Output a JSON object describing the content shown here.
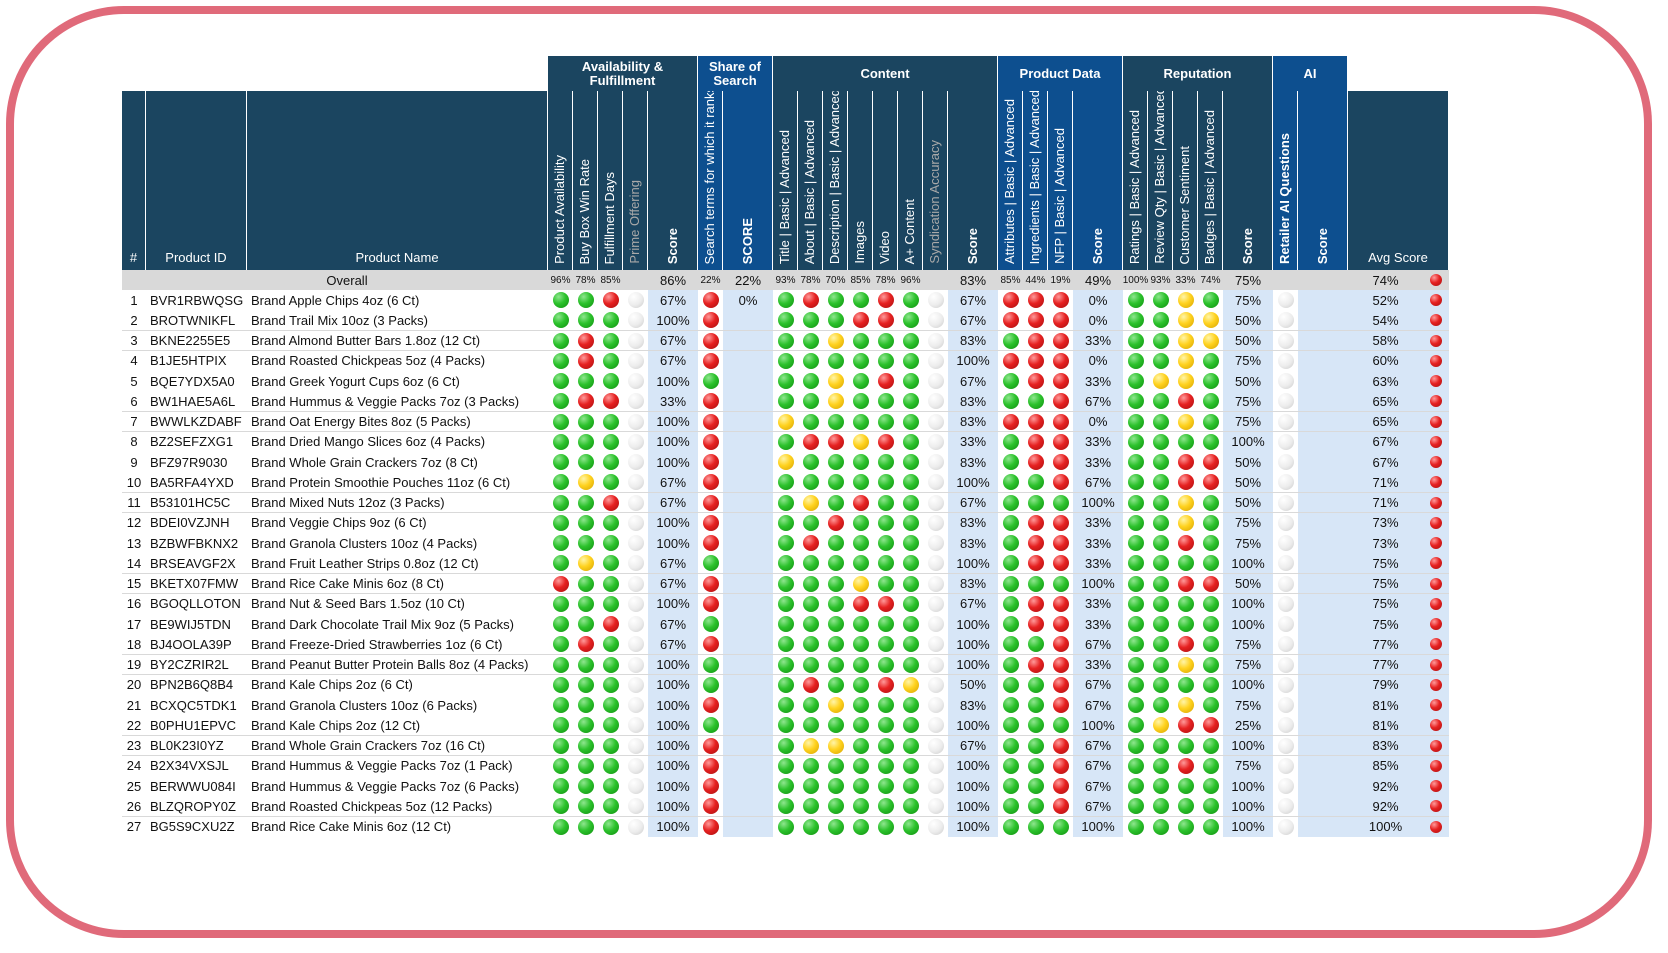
{
  "groups": [
    {
      "label": "Availability & Fulfillment",
      "color": "#1b4560"
    },
    {
      "label": "Share of Search",
      "color": "#0d4f8f"
    },
    {
      "label": "Content",
      "color": "#1b4560"
    },
    {
      "label": "Product Data",
      "color": "#0d4f8f"
    },
    {
      "label": "Reputation",
      "color": "#1b4560"
    },
    {
      "label": "AI",
      "color": "#0d4f8f"
    }
  ],
  "headers": {
    "num": "#",
    "product_id": "Product ID",
    "product_name": "Product Name",
    "metrics": [
      "Product Availability",
      "Buy Box Win Rate",
      "Fulfillment Days",
      "Prime Offering",
      "Score",
      "Search terms for which it ranks",
      "SCORE",
      "Title | Basic | Advanced",
      "About | Basic | Advanced",
      "Description | Basic | Advanced",
      "Images",
      "Video",
      "A+ Content",
      "Syndication Accuracy",
      "Score",
      "Attributes | Basic | Advanced",
      "Ingredients | Basic | Advanced",
      "NFP | Basic | Advanced",
      "Score",
      "Ratings | Basic | Advanced",
      "Review Qty | Basic | Advanced",
      "Customer Sentiment",
      "Badges | Basic | Advanced",
      "Score",
      "Retailer AI Questions",
      "Score"
    ],
    "avg_score": "Avg Score"
  },
  "overall": {
    "label": "Overall",
    "values": [
      "96%",
      "78%",
      "85%",
      "",
      "86%",
      "22%",
      "22%",
      "93%",
      "78%",
      "70%",
      "85%",
      "78%",
      "96%",
      "",
      "83%",
      "85%",
      "44%",
      "19%",
      "49%",
      "100%",
      "93%",
      "33%",
      "74%",
      "75%",
      "",
      ""
    ],
    "avg": "74%",
    "status": "R"
  },
  "rows": [
    {
      "num": "1",
      "id": "BVR1RBWQSG",
      "name": "Brand Apple Chips 4oz (6 Ct)",
      "af": "GGRN",
      "af_score": "67%",
      "sos": "R",
      "sos_score": "0%",
      "content": "GRGGRGN",
      "content_score": "67%",
      "pd": "RRR",
      "pd_score": "0%",
      "rep": "GGYG",
      "rep_score": "75%",
      "ai": "N",
      "ai_score": "",
      "avg": "52%",
      "status": "R"
    },
    {
      "num": "2",
      "id": "BROTWNIKFL",
      "name": "Brand Trail Mix 10oz (3 Packs)",
      "af": "GGGN",
      "af_score": "100%",
      "sos": "R",
      "sos_score": "",
      "content": "GGGRRGN",
      "content_score": "67%",
      "pd": "RRR",
      "pd_score": "0%",
      "rep": "GGYY",
      "rep_score": "50%",
      "ai": "N",
      "ai_score": "",
      "avg": "54%",
      "status": "R"
    },
    {
      "num": "3",
      "id": "BKNE2255E5",
      "name": "Brand Almond Butter Bars 1.8oz (12 Ct)",
      "af": "GRGN",
      "af_score": "67%",
      "sos": "R",
      "sos_score": "",
      "content": "GGYGGGN",
      "content_score": "83%",
      "pd": "GRR",
      "pd_score": "33%",
      "rep": "GGYY",
      "rep_score": "50%",
      "ai": "N",
      "ai_score": "",
      "avg": "58%",
      "status": "R"
    },
    {
      "num": "4",
      "id": "B1JE5HTPIX",
      "name": "Brand Roasted Chickpeas 5oz (4 Packs)",
      "af": "GRGN",
      "af_score": "67%",
      "sos": "R",
      "sos_score": "",
      "content": "GGGGGGN",
      "content_score": "100%",
      "pd": "RRR",
      "pd_score": "0%",
      "rep": "GGYG",
      "rep_score": "75%",
      "ai": "N",
      "ai_score": "",
      "avg": "60%",
      "status": "R"
    },
    {
      "num": "5",
      "id": "BQE7YDX5A0",
      "name": "Brand Greek Yogurt Cups 6oz (6 Ct)",
      "af": "GGGN",
      "af_score": "100%",
      "sos": "G",
      "sos_score": "",
      "content": "GGYGRGN",
      "content_score": "67%",
      "pd": "GRR",
      "pd_score": "33%",
      "rep": "GYYG",
      "rep_score": "50%",
      "ai": "N",
      "ai_score": "",
      "avg": "63%",
      "status": "R"
    },
    {
      "num": "6",
      "id": "BW1HAE5A6L",
      "name": "Brand Hummus & Veggie Packs 7oz (3 Packs)",
      "af": "GRRN",
      "af_score": "33%",
      "sos": "R",
      "sos_score": "",
      "content": "GGYGGGN",
      "content_score": "83%",
      "pd": "GGR",
      "pd_score": "67%",
      "rep": "GGRG",
      "rep_score": "75%",
      "ai": "N",
      "ai_score": "",
      "avg": "65%",
      "status": "R"
    },
    {
      "num": "7",
      "id": "BWWLKZDABF",
      "name": "Brand Oat Energy Bites 8oz (5 Packs)",
      "af": "GGGN",
      "af_score": "100%",
      "sos": "R",
      "sos_score": "",
      "content": "YGGGGGN",
      "content_score": "83%",
      "pd": "RRR",
      "pd_score": "0%",
      "rep": "GGYG",
      "rep_score": "75%",
      "ai": "N",
      "ai_score": "",
      "avg": "65%",
      "status": "R"
    },
    {
      "num": "8",
      "id": "BZ2SEFZXG1",
      "name": "Brand Dried Mango Slices 6oz (4 Packs)",
      "af": "GGGN",
      "af_score": "100%",
      "sos": "R",
      "sos_score": "",
      "content": "GRRYRGN",
      "content_score": "33%",
      "pd": "GRR",
      "pd_score": "33%",
      "rep": "GGGG",
      "rep_score": "100%",
      "ai": "N",
      "ai_score": "",
      "avg": "67%",
      "status": "R"
    },
    {
      "num": "9",
      "id": "BFZ97R9030",
      "name": "Brand Whole Grain Crackers 7oz (8 Ct)",
      "af": "GGGN",
      "af_score": "100%",
      "sos": "R",
      "sos_score": "",
      "content": "YGGGGGN",
      "content_score": "83%",
      "pd": "GRR",
      "pd_score": "33%",
      "rep": "GGRR",
      "rep_score": "50%",
      "ai": "N",
      "ai_score": "",
      "avg": "67%",
      "status": "R"
    },
    {
      "num": "10",
      "id": "BA5RFA4YXD",
      "name": "Brand Protein Smoothie Pouches 11oz (6 Ct)",
      "af": "GYGN",
      "af_score": "67%",
      "sos": "R",
      "sos_score": "",
      "content": "GGGGGGN",
      "content_score": "100%",
      "pd": "GGR",
      "pd_score": "67%",
      "rep": "GGRR",
      "rep_score": "50%",
      "ai": "N",
      "ai_score": "",
      "avg": "71%",
      "status": "R"
    },
    {
      "num": "11",
      "id": "B53101HC5C",
      "name": "Brand Mixed Nuts 12oz (3 Packs)",
      "af": "GGRN",
      "af_score": "67%",
      "sos": "R",
      "sos_score": "",
      "content": "GYGRGGN",
      "content_score": "67%",
      "pd": "GGG",
      "pd_score": "100%",
      "rep": "GGYG",
      "rep_score": "50%",
      "ai": "N",
      "ai_score": "",
      "avg": "71%",
      "status": "R"
    },
    {
      "num": "12",
      "id": "BDEI0VZJNH",
      "name": "Brand Veggie Chips 9oz (6 Ct)",
      "af": "GGGN",
      "af_score": "100%",
      "sos": "R",
      "sos_score": "",
      "content": "GGRGGGN",
      "content_score": "83%",
      "pd": "GRR",
      "pd_score": "33%",
      "rep": "GGYG",
      "rep_score": "75%",
      "ai": "N",
      "ai_score": "",
      "avg": "73%",
      "status": "R"
    },
    {
      "num": "13",
      "id": "BZBWFBKNX2",
      "name": "Brand Granola Clusters 10oz (4 Packs)",
      "af": "GGGN",
      "af_score": "100%",
      "sos": "R",
      "sos_score": "",
      "content": "GRGGGGN",
      "content_score": "83%",
      "pd": "GRR",
      "pd_score": "33%",
      "rep": "GGRG",
      "rep_score": "75%",
      "ai": "N",
      "ai_score": "",
      "avg": "73%",
      "status": "R"
    },
    {
      "num": "14",
      "id": "BRSEAVGF2X",
      "name": "Brand Fruit Leather Strips 0.8oz (12 Ct)",
      "af": "GYGN",
      "af_score": "67%",
      "sos": "G",
      "sos_score": "",
      "content": "GGGGGGN",
      "content_score": "100%",
      "pd": "GRR",
      "pd_score": "33%",
      "rep": "GGGG",
      "rep_score": "100%",
      "ai": "N",
      "ai_score": "",
      "avg": "75%",
      "status": "R"
    },
    {
      "num": "15",
      "id": "BKETX07FMW",
      "name": "Brand Rice Cake Minis 6oz (8 Ct)",
      "af": "RGGN",
      "af_score": "67%",
      "sos": "R",
      "sos_score": "",
      "content": "GGGYGGN",
      "content_score": "83%",
      "pd": "GGG",
      "pd_score": "100%",
      "rep": "GGRR",
      "rep_score": "50%",
      "ai": "N",
      "ai_score": "",
      "avg": "75%",
      "status": "R"
    },
    {
      "num": "16",
      "id": "BGOQLLOTON",
      "name": "Brand Nut & Seed Bars 1.5oz (10 Ct)",
      "af": "GGGN",
      "af_score": "100%",
      "sos": "R",
      "sos_score": "",
      "content": "GGGRRGN",
      "content_score": "67%",
      "pd": "GRR",
      "pd_score": "33%",
      "rep": "GGGG",
      "rep_score": "100%",
      "ai": "N",
      "ai_score": "",
      "avg": "75%",
      "status": "R"
    },
    {
      "num": "17",
      "id": "BE9WIJ5TDN",
      "name": "Brand Dark Chocolate Trail Mix 9oz (5 Packs)",
      "af": "GGRN",
      "af_score": "67%",
      "sos": "G",
      "sos_score": "",
      "content": "GGGGGGN",
      "content_score": "100%",
      "pd": "GRR",
      "pd_score": "33%",
      "rep": "GGGG",
      "rep_score": "100%",
      "ai": "N",
      "ai_score": "",
      "avg": "75%",
      "status": "R"
    },
    {
      "num": "18",
      "id": "BJ4OOLA39P",
      "name": "Brand Freeze-Dried Strawberries 1oz (6 Ct)",
      "af": "GRGN",
      "af_score": "67%",
      "sos": "R",
      "sos_score": "",
      "content": "GGGGGGN",
      "content_score": "100%",
      "pd": "GGR",
      "pd_score": "67%",
      "rep": "GGRG",
      "rep_score": "75%",
      "ai": "N",
      "ai_score": "",
      "avg": "77%",
      "status": "R"
    },
    {
      "num": "19",
      "id": "BY2CZRIR2L",
      "name": "Brand Peanut Butter Protein Balls 8oz (4 Packs)",
      "af": "GGGN",
      "af_score": "100%",
      "sos": "G",
      "sos_score": "",
      "content": "GGGGGGN",
      "content_score": "100%",
      "pd": "GRR",
      "pd_score": "33%",
      "rep": "GGYG",
      "rep_score": "75%",
      "ai": "N",
      "ai_score": "",
      "avg": "77%",
      "status": "R"
    },
    {
      "num": "20",
      "id": "BPN2B6Q8B4",
      "name": "Brand Kale Chips 2oz (6 Ct)",
      "af": "GGGN",
      "af_score": "100%",
      "sos": "G",
      "sos_score": "",
      "content": "GRGGRYN",
      "content_score": "50%",
      "pd": "GGR",
      "pd_score": "67%",
      "rep": "GGGG",
      "rep_score": "100%",
      "ai": "N",
      "ai_score": "",
      "avg": "79%",
      "status": "R"
    },
    {
      "num": "21",
      "id": "BCXQC5TDK1",
      "name": "Brand Granola Clusters 10oz (6 Packs)",
      "af": "GGGN",
      "af_score": "100%",
      "sos": "R",
      "sos_score": "",
      "content": "GGYGGGN",
      "content_score": "83%",
      "pd": "GGR",
      "pd_score": "67%",
      "rep": "GGYG",
      "rep_score": "75%",
      "ai": "N",
      "ai_score": "",
      "avg": "81%",
      "status": "R"
    },
    {
      "num": "22",
      "id": "B0PHU1EPVC",
      "name": "Brand Kale Chips 2oz (12 Ct)",
      "af": "GGGN",
      "af_score": "100%",
      "sos": "G",
      "sos_score": "",
      "content": "GGGGGGN",
      "content_score": "100%",
      "pd": "GGG",
      "pd_score": "100%",
      "rep": "GYRR",
      "rep_score": "25%",
      "ai": "N",
      "ai_score": "",
      "avg": "81%",
      "status": "R"
    },
    {
      "num": "23",
      "id": "BL0K23I0YZ",
      "name": "Brand Whole Grain Crackers 7oz (16 Ct)",
      "af": "GGGN",
      "af_score": "100%",
      "sos": "R",
      "sos_score": "",
      "content": "GYYGGGN",
      "content_score": "67%",
      "pd": "GGR",
      "pd_score": "67%",
      "rep": "GGGG",
      "rep_score": "100%",
      "ai": "N",
      "ai_score": "",
      "avg": "83%",
      "status": "R"
    },
    {
      "num": "24",
      "id": "B2X34VXSJL",
      "name": "Brand Hummus & Veggie Packs 7oz (1 Pack)",
      "af": "GGGN",
      "af_score": "100%",
      "sos": "R",
      "sos_score": "",
      "content": "GGGGGGN",
      "content_score": "100%",
      "pd": "GGR",
      "pd_score": "67%",
      "rep": "GGRG",
      "rep_score": "75%",
      "ai": "N",
      "ai_score": "",
      "avg": "85%",
      "status": "R"
    },
    {
      "num": "25",
      "id": "BERWWU084I",
      "name": "Brand Hummus & Veggie Packs 7oz (6 Packs)",
      "af": "GGGN",
      "af_score": "100%",
      "sos": "R",
      "sos_score": "",
      "content": "GGGGGGN",
      "content_score": "100%",
      "pd": "GGR",
      "pd_score": "67%",
      "rep": "GGGG",
      "rep_score": "100%",
      "ai": "N",
      "ai_score": "",
      "avg": "92%",
      "status": "R"
    },
    {
      "num": "26",
      "id": "BLZQROPY0Z",
      "name": "Brand Roasted Chickpeas 5oz (12 Packs)",
      "af": "GGGN",
      "af_score": "100%",
      "sos": "R",
      "sos_score": "",
      "content": "GGGGGGN",
      "content_score": "100%",
      "pd": "GGR",
      "pd_score": "67%",
      "rep": "GGGG",
      "rep_score": "100%",
      "ai": "N",
      "ai_score": "",
      "avg": "92%",
      "status": "R"
    },
    {
      "num": "27",
      "id": "BG5S9CXU2Z",
      "name": "Brand Rice Cake Minis 6oz (12 Ct)",
      "af": "GGGN",
      "af_score": "100%",
      "sos": "R",
      "sos_score": "",
      "content": "GGGGGGN",
      "content_score": "100%",
      "pd": "GGG",
      "pd_score": "100%",
      "rep": "GGGG",
      "rep_score": "100%",
      "ai": "N",
      "ai_score": "",
      "avg": "100%",
      "status": "R"
    }
  ]
}
